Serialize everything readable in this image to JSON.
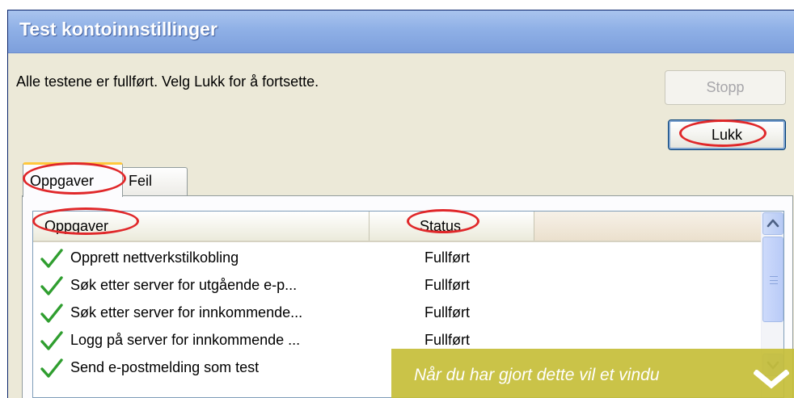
{
  "window": {
    "title": "Test kontoinnstillinger"
  },
  "status_message": "Alle testene er fullført. Velg Lukk for å fortsette.",
  "buttons": {
    "stop": "Stopp",
    "close": "Lukk"
  },
  "tabs": [
    {
      "label": "Oppgaver",
      "selected": true
    },
    {
      "label": "Feil",
      "selected": false
    }
  ],
  "list": {
    "columns": [
      "Oppgaver",
      "Status"
    ],
    "rows": [
      {
        "task": "Opprett nettverkstilkobling",
        "status": "Fullført"
      },
      {
        "task": "Søk etter server for utgående e-p...",
        "status": "Fullført"
      },
      {
        "task": "Søk etter server for innkommende...",
        "status": "Fullført"
      },
      {
        "task": "Logg på server for innkommende ...",
        "status": "Fullført"
      },
      {
        "task": "Send e-postmelding som test",
        "status": ""
      }
    ]
  },
  "caption": {
    "text": "Når du har gjort dette vil et vindu"
  },
  "colors": {
    "highlight_ring": "#e0282a",
    "caption_bg": "#c6be3a",
    "check_green": "#2f9e2f",
    "titlebar": "#8fb0e6"
  },
  "icons": {
    "row": "check-icon",
    "caption": "chevron-down-icon",
    "scroll_up": "arrow-up-icon",
    "scroll_down": "arrow-down-icon"
  }
}
